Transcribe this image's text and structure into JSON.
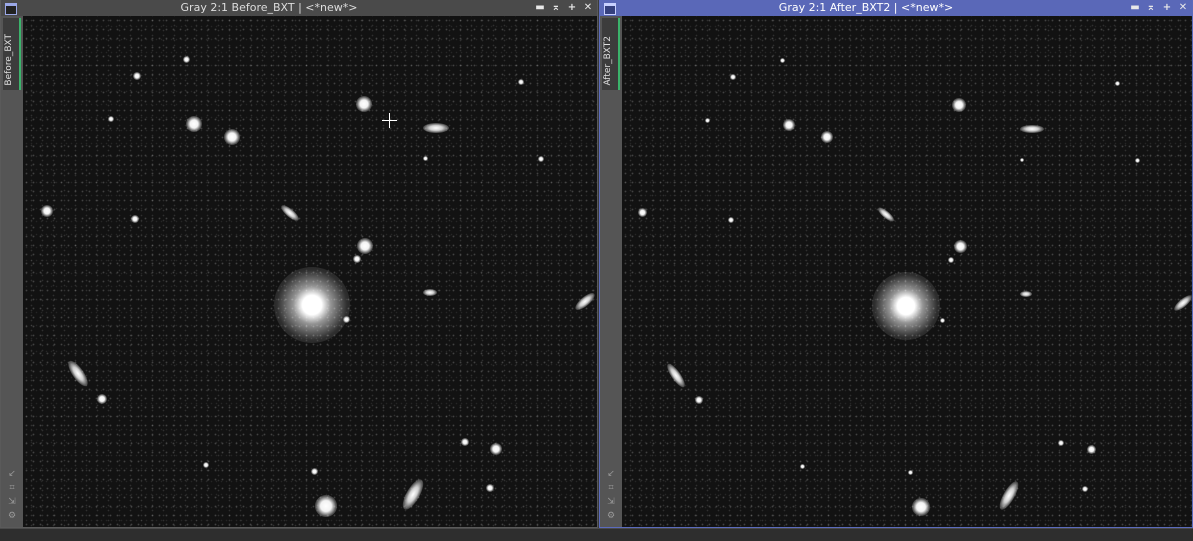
{
  "windows": [
    {
      "title": "Gray 2:1 Before_BXT | <*new*>",
      "view_tab": "Before_BXT",
      "active": false
    },
    {
      "title": "Gray 2:1 After_BXT2 | <*new*>",
      "view_tab": "After_BXT2",
      "active": true
    }
  ],
  "controls": {
    "minimize": "▬",
    "shade": "⌅",
    "maximize": "+",
    "close": "✕"
  },
  "icons": {
    "window": "window-icon",
    "minimize": "minimize-icon",
    "shade": "shade-icon",
    "maximize": "maximize-icon",
    "close": "close-icon",
    "side_icons": [
      "pin-icon",
      "lock-icon",
      "link-icon",
      "gear-icon"
    ]
  },
  "colors": {
    "active_titlebar": "#5a68b8",
    "inactive_titlebar": "#4a4a4a",
    "view_tab_accent": "#3bb36b",
    "sky_background": "#121212"
  }
}
